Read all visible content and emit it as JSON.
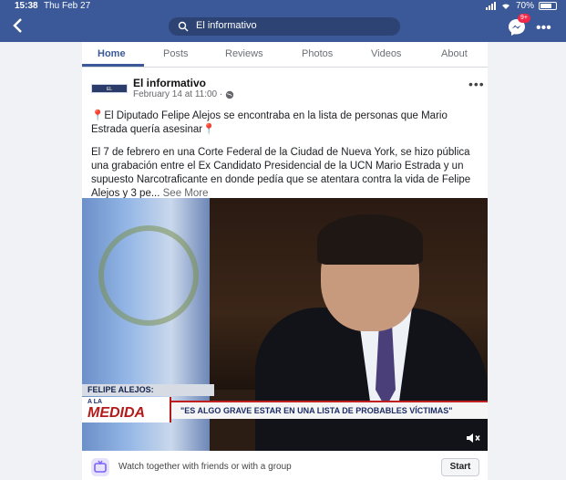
{
  "status_bar": {
    "time": "15:38",
    "date": "Thu Feb 27",
    "battery": "70%"
  },
  "nav": {
    "search_text": "El informativo",
    "messenger_badge": "9+"
  },
  "tabs": [
    {
      "label": "Home",
      "active": true
    },
    {
      "label": "Posts",
      "active": false
    },
    {
      "label": "Reviews",
      "active": false
    },
    {
      "label": "Photos",
      "active": false
    },
    {
      "label": "Videos",
      "active": false
    },
    {
      "label": "About",
      "active": false
    }
  ],
  "post": {
    "page_name": "El informativo",
    "logo_text": "EL INFORMATIVO",
    "timestamp": "February 14 at 11:00 ·",
    "paragraph1": "El Diputado Felipe Alejos se encontraba en la lista de personas que Mario Estrada quería asesinar",
    "paragraph2": "El 7 de febrero en una Corte Federal de la Ciudad de Nueva York, se hizo pública una grabación entre el Ex Candidato Presidencial de la UCN Mario Estrada y un supuesto Narcotraficante en donde pedía que se atentara contra la vida de Felipe Alejos y 3 pe...",
    "see_more": "See More"
  },
  "video": {
    "lower_name": "FELIPE ALEJOS:",
    "show_name_top": "A LA",
    "show_name": "MEDIDA",
    "quote": "\"ES ALGO GRAVE ESTAR EN UNA LISTA DE PROBABLES VÍCTIMAS\""
  },
  "watch_bar": {
    "text": "Watch together with friends or with a group",
    "start_label": "Start"
  },
  "colors": {
    "brand": "#3b5998",
    "background": "#f0f2f5"
  }
}
